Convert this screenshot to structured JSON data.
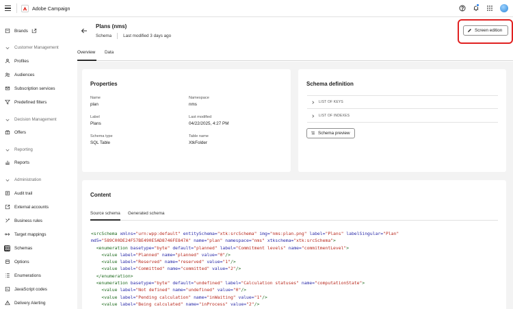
{
  "app": {
    "name": "Adobe Campaign"
  },
  "sidebar": {
    "items": [
      {
        "type": "item",
        "label": "Brands",
        "icon": "brands-icon"
      },
      {
        "type": "section",
        "label": "Customer Management"
      },
      {
        "type": "item",
        "label": "Profiles",
        "icon": "profiles-icon"
      },
      {
        "type": "item",
        "label": "Audiences",
        "icon": "audiences-icon"
      },
      {
        "type": "item",
        "label": "Subscription services",
        "icon": "subscription-icon"
      },
      {
        "type": "item",
        "label": "Predefined filters",
        "icon": "filter-icon"
      },
      {
        "type": "section",
        "label": "Decision Management"
      },
      {
        "type": "item",
        "label": "Offers",
        "icon": "offers-icon"
      },
      {
        "type": "section",
        "label": "Reporting"
      },
      {
        "type": "item",
        "label": "Reports",
        "icon": "reports-icon"
      },
      {
        "type": "section",
        "label": "Administration"
      },
      {
        "type": "item",
        "label": "Audit trail",
        "icon": "audit-icon"
      },
      {
        "type": "item",
        "label": "External accounts",
        "icon": "external-accounts-icon"
      },
      {
        "type": "item",
        "label": "Business rules",
        "icon": "business-rules-icon"
      },
      {
        "type": "item",
        "label": "Target mappings",
        "icon": "target-mappings-icon"
      },
      {
        "type": "item",
        "label": "Schemas",
        "icon": "schemas-icon",
        "active": true
      },
      {
        "type": "item",
        "label": "Options",
        "icon": "options-icon"
      },
      {
        "type": "item",
        "label": "Enumerations",
        "icon": "enumerations-icon"
      },
      {
        "type": "item",
        "label": "JavaScript codes",
        "icon": "javascript-icon"
      },
      {
        "type": "item",
        "label": "Delivery Alerting",
        "icon": "alerting-icon"
      }
    ]
  },
  "header": {
    "title": "Plans (nms)",
    "type": "Schema",
    "modified": "Last modified 3 days ago",
    "screen_edition": "Screen edition"
  },
  "tabs": [
    "Overview",
    "Data"
  ],
  "properties": {
    "title": "Properties",
    "fields": [
      {
        "label": "Name",
        "value": "plan"
      },
      {
        "label": "Namespace",
        "value": "nms"
      },
      {
        "label": "Label",
        "value": "Plans"
      },
      {
        "label": "Last modified",
        "value": "04/22/2025, 4:27 PM"
      },
      {
        "label": "Schema type",
        "value": "SQL Table"
      },
      {
        "label": "Table name",
        "value": "XtkFolder"
      }
    ]
  },
  "schema_definition": {
    "title": "Schema definition",
    "list_of_keys": "LIST OF KEYS",
    "list_of_indexes": "LIST OF INDEXES",
    "preview_button": "Schema preview"
  },
  "content": {
    "title": "Content",
    "subtabs": [
      "Source schema",
      "Generated schema"
    ],
    "code_lines": [
      [
        [
          "tag",
          "<srcSchema "
        ],
        [
          "attr",
          "xmlns="
        ],
        [
          "val",
          "\"urn:wpp:default\" "
        ],
        [
          "attr",
          "entitySchema="
        ],
        [
          "val",
          "\"xtk:srcSchema\" "
        ],
        [
          "attr",
          "img="
        ],
        [
          "val",
          "\"nms:plan.png\" "
        ],
        [
          "attr",
          "label="
        ],
        [
          "val",
          "\"Plans\" "
        ],
        [
          "attr",
          "labelSingular="
        ],
        [
          "val",
          "\"Plan\""
        ]
      ],
      [
        [
          "attr",
          "md5="
        ],
        [
          "val",
          "\"589C00DE24F57BE490E5AD8746FE847A\" "
        ],
        [
          "attr",
          "name="
        ],
        [
          "val",
          "\"plan\" "
        ],
        [
          "attr",
          "namespace="
        ],
        [
          "val",
          "\"nms\" "
        ],
        [
          "attr",
          "xtkschema="
        ],
        [
          "val",
          "\"xtk:srcSchema\""
        ],
        [
          "tag",
          ">"
        ]
      ],
      [
        [
          "plain",
          "  "
        ],
        [
          "tag",
          "<enumeration "
        ],
        [
          "attr",
          "basetype="
        ],
        [
          "val",
          "\"byte\" "
        ],
        [
          "attr",
          "default="
        ],
        [
          "val",
          "\"planned\" "
        ],
        [
          "attr",
          "label="
        ],
        [
          "val",
          "\"Commitment levels\" "
        ],
        [
          "attr",
          "name="
        ],
        [
          "val",
          "\"commitmentLevel\""
        ],
        [
          "tag",
          ">"
        ]
      ],
      [
        [
          "plain",
          "    "
        ],
        [
          "tag",
          "<value "
        ],
        [
          "attr",
          "label="
        ],
        [
          "val",
          "\"Planned\" "
        ],
        [
          "attr",
          "name="
        ],
        [
          "val",
          "\"planned\" "
        ],
        [
          "attr",
          "value="
        ],
        [
          "val",
          "\"0\""
        ],
        [
          "tag",
          "/>"
        ]
      ],
      [
        [
          "plain",
          "    "
        ],
        [
          "tag",
          "<value "
        ],
        [
          "attr",
          "label="
        ],
        [
          "val",
          "\"Reserved\" "
        ],
        [
          "attr",
          "name="
        ],
        [
          "val",
          "\"reserved\" "
        ],
        [
          "attr",
          "value="
        ],
        [
          "val",
          "\"1\""
        ],
        [
          "tag",
          "/>"
        ]
      ],
      [
        [
          "plain",
          "    "
        ],
        [
          "tag",
          "<value "
        ],
        [
          "attr",
          "label="
        ],
        [
          "val",
          "\"Committed\" "
        ],
        [
          "attr",
          "name="
        ],
        [
          "val",
          "\"committed\" "
        ],
        [
          "attr",
          "value="
        ],
        [
          "val",
          "\"2\""
        ],
        [
          "tag",
          "/>"
        ]
      ],
      [
        [
          "plain",
          "  "
        ],
        [
          "tag",
          "</enumeration>"
        ]
      ],
      [
        [
          "plain",
          "  "
        ],
        [
          "tag",
          "<enumeration "
        ],
        [
          "attr",
          "basetype="
        ],
        [
          "val",
          "\"byte\" "
        ],
        [
          "attr",
          "default="
        ],
        [
          "val",
          "\"undefined\" "
        ],
        [
          "attr",
          "label="
        ],
        [
          "val",
          "\"Calculation statuses\" "
        ],
        [
          "attr",
          "name="
        ],
        [
          "val",
          "\"computationState\""
        ],
        [
          "tag",
          ">"
        ]
      ],
      [
        [
          "plain",
          "    "
        ],
        [
          "tag",
          "<value "
        ],
        [
          "attr",
          "label="
        ],
        [
          "val",
          "\"Not defined\" "
        ],
        [
          "attr",
          "name="
        ],
        [
          "val",
          "\"undefined\" "
        ],
        [
          "attr",
          "value="
        ],
        [
          "val",
          "\"0\""
        ],
        [
          "tag",
          "/>"
        ]
      ],
      [
        [
          "plain",
          "    "
        ],
        [
          "tag",
          "<value "
        ],
        [
          "attr",
          "label="
        ],
        [
          "val",
          "\"Pending calculation\" "
        ],
        [
          "attr",
          "name="
        ],
        [
          "val",
          "\"inWaiting\" "
        ],
        [
          "attr",
          "value="
        ],
        [
          "val",
          "\"1\""
        ],
        [
          "tag",
          "/>"
        ]
      ],
      [
        [
          "plain",
          "    "
        ],
        [
          "tag",
          "<value "
        ],
        [
          "attr",
          "label="
        ],
        [
          "val",
          "\"Being calculated\" "
        ],
        [
          "attr",
          "name="
        ],
        [
          "val",
          "\"inProcess\" "
        ],
        [
          "attr",
          "value="
        ],
        [
          "val",
          "\"2\""
        ],
        [
          "tag",
          "/>"
        ]
      ]
    ]
  },
  "colors": {
    "highlight_border": "#e02020",
    "code_tag": "#1d6a1d",
    "code_attr": "#2a2aa8",
    "code_value": "#b8291e"
  }
}
